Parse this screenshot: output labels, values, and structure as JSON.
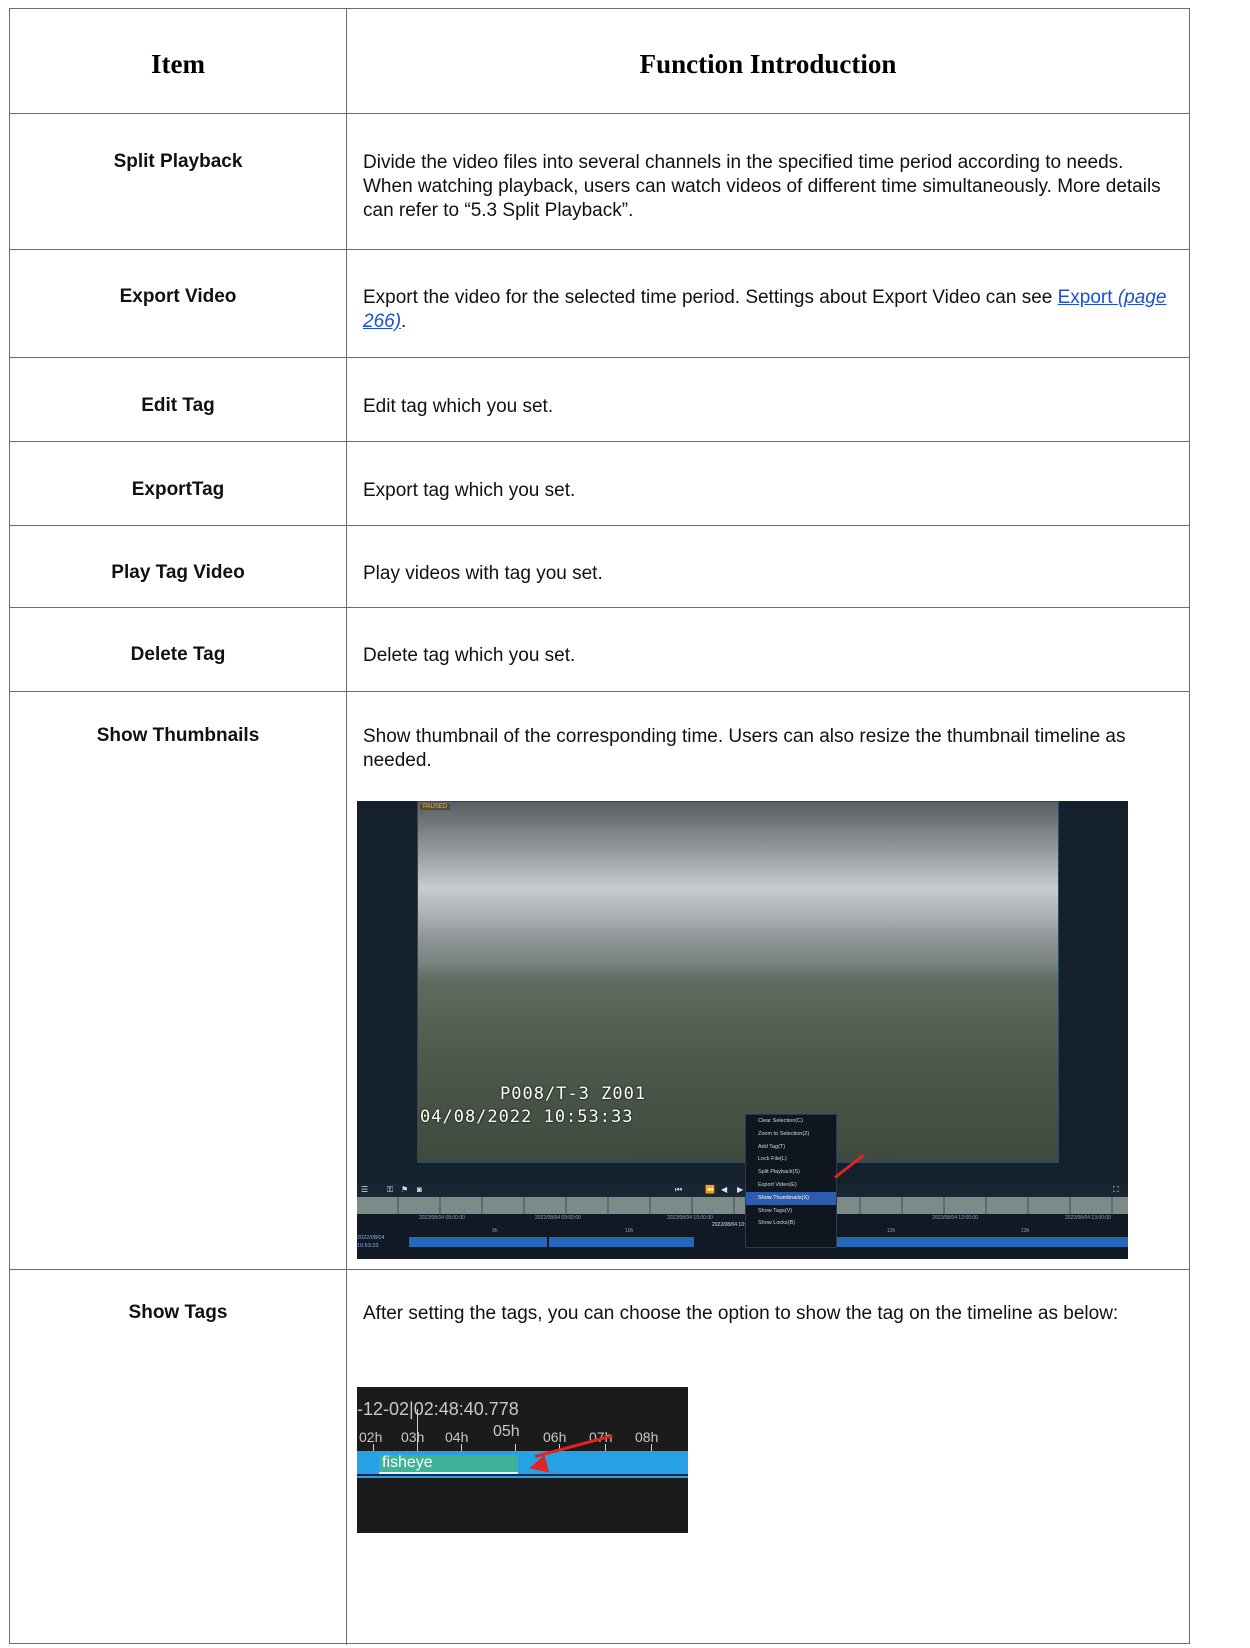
{
  "header": {
    "col1": "Item",
    "col2": "Function Introduction"
  },
  "rows": [
    {
      "item": "Split Playback",
      "desc": "Divide the video files into several channels in the specified time period according to needs. When watching playback, users can watch videos of different time simultaneously. More details can refer to “5.3 Split Playback”."
    },
    {
      "item": "Export Video",
      "desc_prefix": "Export the video for the selected time period. Settings about Export Video can see ",
      "link_text": "Export",
      "link_page": "(page 266)",
      "desc_suffix": "."
    },
    {
      "item": "Edit Tag",
      "desc": "Edit tag which you set."
    },
    {
      "item": "ExportTag",
      "desc": "Export tag which you set."
    },
    {
      "item": "Play Tag Video",
      "desc": "Play videos with tag you set."
    },
    {
      "item": "Delete Tag",
      "desc": "Delete tag which you set."
    },
    {
      "item": "Show Thumbnails",
      "desc": "Show thumbnail of the corresponding time. Users can also resize the thumbnail timeline as needed."
    },
    {
      "item": "Show Tags",
      "desc": "After setting the tags, you can choose the option to show the tag on the timeline as below:"
    }
  ],
  "playback_screenshot": {
    "badge": "PAUSED",
    "osd_line1": "P008/T-3   Z001",
    "osd_line2": "04/08/2022 10:53:33",
    "context_menu": [
      "Clear Selection(C)",
      "Zoom to Selection(Z)",
      "Add Tag(T)",
      "Lock File(L)",
      "Split Playback(S)",
      "Export Video(E)",
      "Show Thumbnails(X)",
      "Show Tags(V)",
      "Show Locks(B)"
    ],
    "active_menu_item": "Show Thumbnails(X)",
    "timeline_dates": [
      "2022/08/04 08:00:00",
      "2022/08/04 09:00:00",
      "2022/08/04 10:00:00",
      "2022/08/04 12:00:00",
      "2022/08/04 13:00:00"
    ],
    "timeline_hours": [
      "9h",
      "10h",
      "12h",
      "13h"
    ],
    "current_datetime": "2022/08/04 10:",
    "side_date": "2022/08/04",
    "side_time": "10:53:33"
  },
  "tag_screenshot": {
    "datetime": "-12-02|02:48:40.778",
    "hours": [
      "02h",
      "03h",
      "04h",
      "05h",
      "06h",
      "07h",
      "08h"
    ],
    "tag_label": "fisheye"
  }
}
